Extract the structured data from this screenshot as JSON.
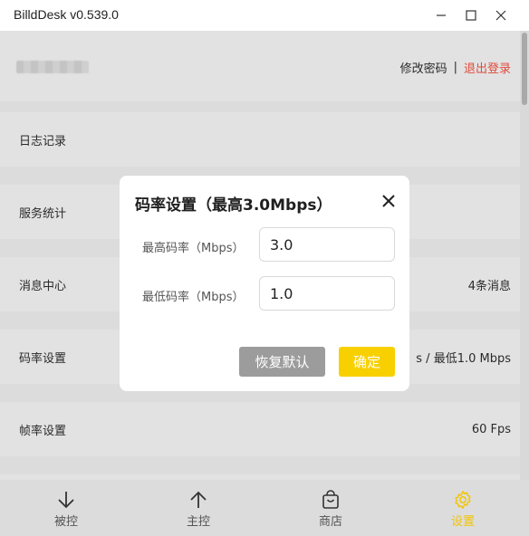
{
  "window": {
    "title": "BilldDesk v0.539.0"
  },
  "account": {
    "change_password": "修改密码",
    "separator": "|",
    "logout": "退出登录"
  },
  "settings": {
    "rows": [
      {
        "label": "日志记录",
        "value": ""
      },
      {
        "label": "服务统计",
        "value": ""
      },
      {
        "label": "消息中心",
        "value": "4条消息"
      },
      {
        "label": "码率设置",
        "value": "s / 最低1.0 Mbps"
      },
      {
        "label": "帧率设置",
        "value": "60 Fps"
      }
    ]
  },
  "nav": {
    "items": [
      {
        "label": "被控",
        "icon": "arrow-down-icon"
      },
      {
        "label": "主控",
        "icon": "arrow-up-icon"
      },
      {
        "label": "商店",
        "icon": "shopping-bag-icon"
      },
      {
        "label": "设置",
        "icon": "gear-icon"
      }
    ],
    "active": "设置"
  },
  "dialog": {
    "title": "码率设置（最高3.0Mbps）",
    "max_label": "最高码率（Mbps）",
    "max_value": "3.0",
    "min_label": "最低码率（Mbps）",
    "min_value": "1.0",
    "reset_label": "恢复默认",
    "ok_label": "确定"
  },
  "colors": {
    "accent": "#f8d000",
    "logout": "#e14b3b",
    "reset_button": "#9c9c9c"
  }
}
